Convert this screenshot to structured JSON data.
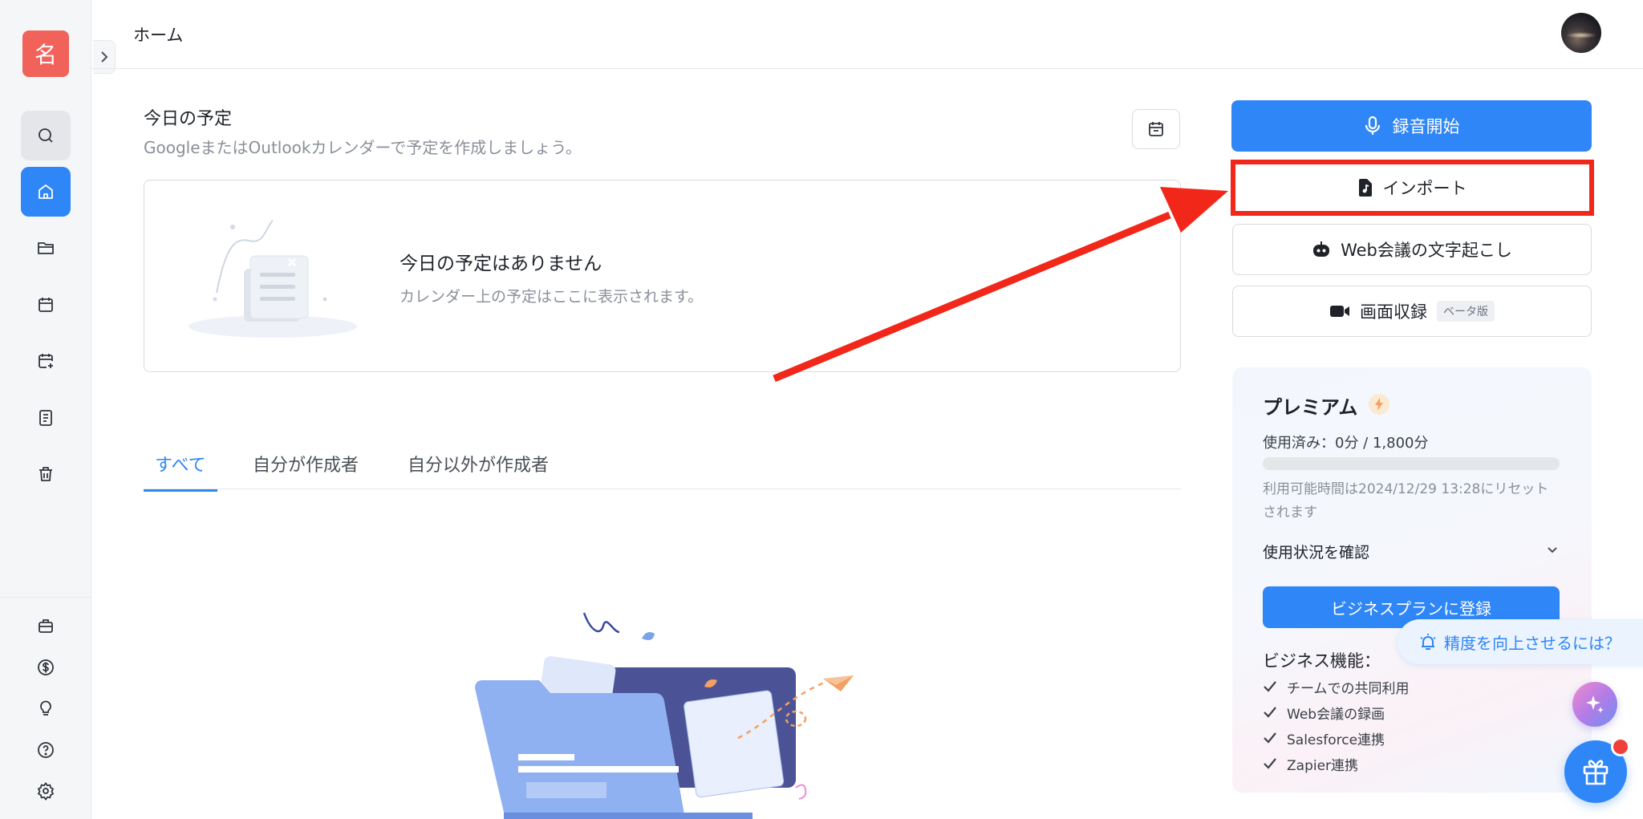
{
  "sidebar": {
    "logo_text": "名",
    "icons": [
      "search-icon",
      "home-icon",
      "folder-icon",
      "calendar-icon",
      "calendar-add-icon",
      "document-icon",
      "trash-icon",
      "briefcase-icon",
      "dollar-icon",
      "lightbulb-icon",
      "help-icon",
      "gear-icon"
    ]
  },
  "header": {
    "title": "ホーム"
  },
  "schedule": {
    "title": "今日の予定",
    "subtitle": "GoogleまたはOutlookカレンダーで予定を作成しましょう。",
    "empty_title": "今日の予定はありません",
    "empty_subtitle": "カレンダー上の予定はここに表示されます。"
  },
  "tabs": [
    {
      "label": "すべて",
      "active": true
    },
    {
      "label": "自分が作成者",
      "active": false
    },
    {
      "label": "自分以外が作成者",
      "active": false
    }
  ],
  "actions": {
    "record_label": "録音開始",
    "import_label": "インポート",
    "web_meeting_label": "Web会議の文字起こし",
    "screen_record_label": "画面収録",
    "beta_badge": "ベータ版"
  },
  "premium": {
    "title": "プレミアム",
    "usage": "使用済み：0分 / 1,800分",
    "usage_fraction": 0,
    "reset_notice": "利用可能時間は2024/12/29 13:28にリセットされます",
    "usage_check_label": "使用状況を確認",
    "business_button": "ビジネスプランに登録",
    "features_title": "ビジネス機能：",
    "features": [
      "チームでの共同利用",
      "Web会議の録画",
      "Salesforce連携",
      "Zapier連携"
    ]
  },
  "tip": {
    "label": "精度を向上させるには？"
  },
  "colors": {
    "accent": "#2f86f6",
    "logo": "#f0625a",
    "annotation": "#f1271a"
  }
}
